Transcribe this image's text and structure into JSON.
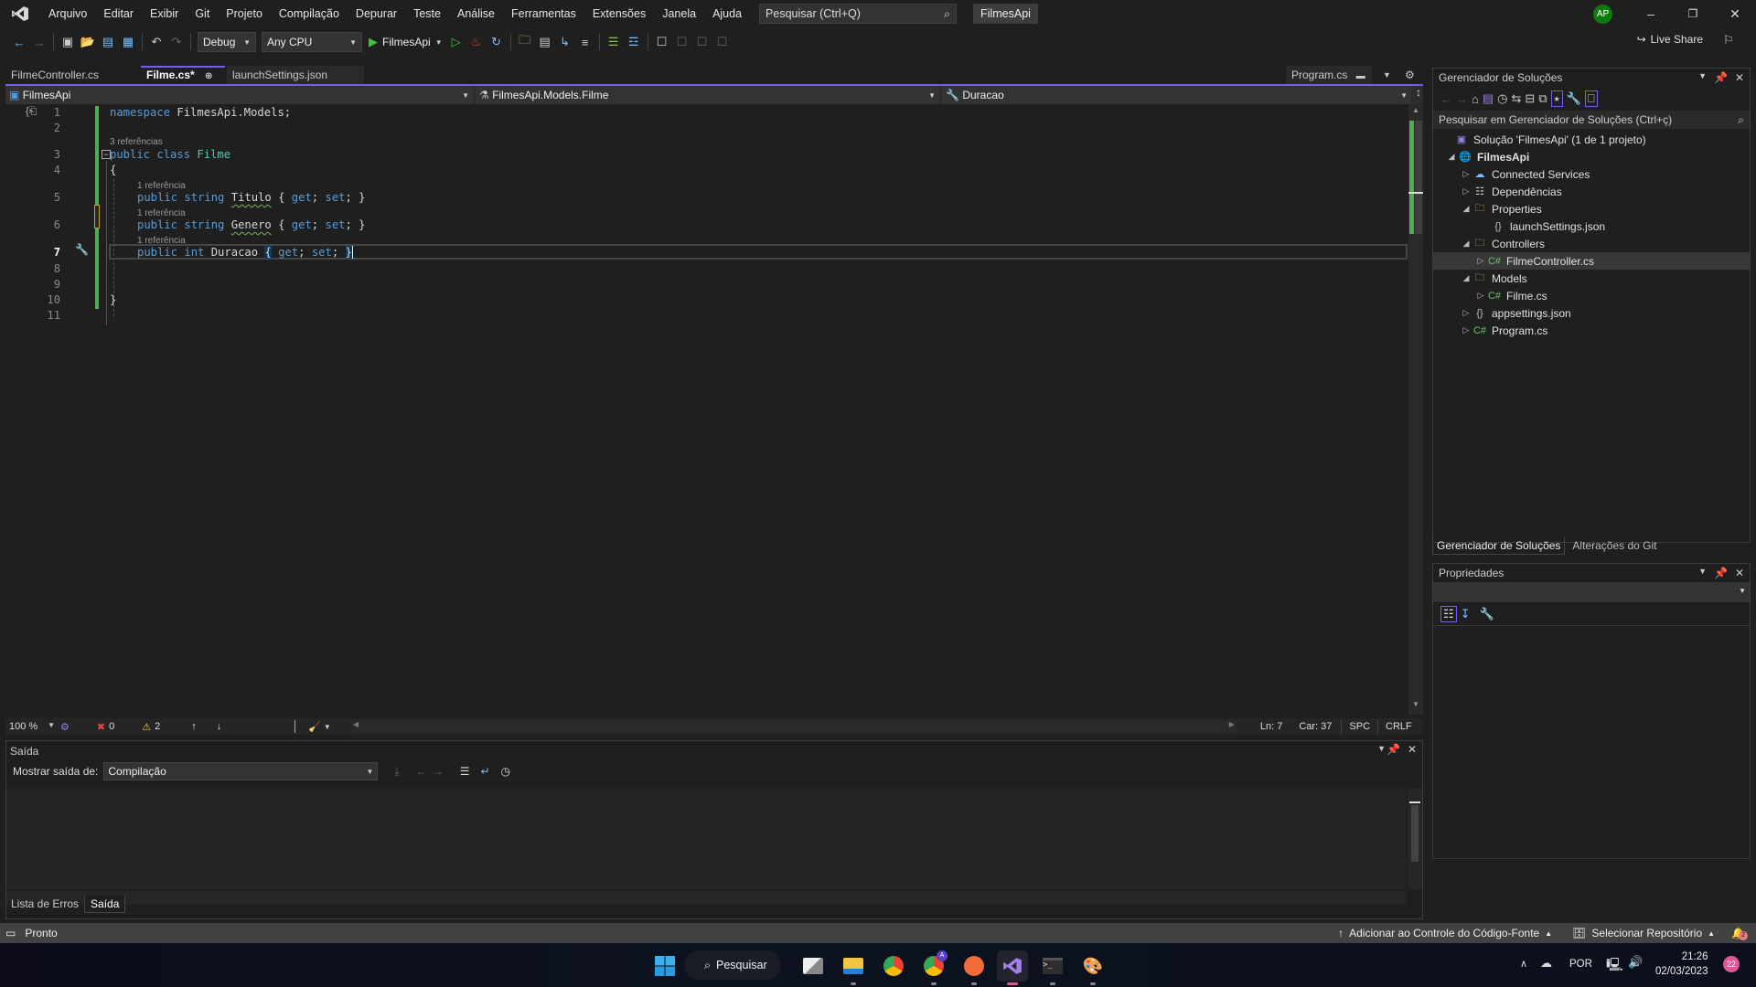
{
  "titlebar": {
    "menu": [
      "Arquivo",
      "Editar",
      "Exibir",
      "Git",
      "Projeto",
      "Compilação",
      "Depurar",
      "Teste",
      "Análise",
      "Ferramentas",
      "Extensões",
      "Janela",
      "Ajuda"
    ],
    "search_placeholder": "Pesquisar (Ctrl+Q)",
    "solution_name": "FilmesApi",
    "avatar_initials": "AP"
  },
  "toolbar": {
    "configuration": "Debug",
    "platform": "Any CPU",
    "run_target": "FilmesApi",
    "live_share": "Live Share"
  },
  "editor": {
    "tabs": [
      {
        "label": "FilmeController.cs",
        "active": false
      },
      {
        "label": "Filme.cs*",
        "active": true
      },
      {
        "label": "launchSettings.json",
        "active": false
      }
    ],
    "pinned_tab": "Program.cs",
    "nav": {
      "project": "FilmesApi",
      "type": "FilmesApi.Models.Filme",
      "member": "Duracao"
    },
    "line_numbers": [
      "1",
      "2",
      "3",
      "4",
      "5",
      "6",
      "7",
      "8",
      "9",
      "10",
      "11"
    ],
    "codelens": {
      "class_refs": "3 referências",
      "prop_refs": "1 referência"
    },
    "code": {
      "l1_kw": "namespace",
      "l1_rest": " FilmesApi.Models;",
      "l3_kw": "public class",
      "l3_cls": "Filme",
      "l4": "{",
      "l5_kw": "public string",
      "l5_name": "Titulo",
      "l5_acc1": "get",
      "l5_acc2": "set",
      "l6_kw": "public string",
      "l6_name": "Genero",
      "l6_acc1": "get",
      "l6_acc2": "set",
      "l7_kw": "public int",
      "l7_name": "Duracao",
      "l7_acc1": "get",
      "l7_acc2": "set",
      "l10": "}"
    },
    "status": {
      "zoom": "100 %",
      "errors": "0",
      "warnings": "2",
      "line": "Ln: 7",
      "col": "Car: 37",
      "indent": "SPC",
      "eol": "CRLF"
    }
  },
  "output": {
    "title": "Saída",
    "show_from_label": "Mostrar saída de:",
    "show_from_value": "Compilação",
    "bottom_tabs": [
      {
        "label": "Lista de Erros",
        "active": false
      },
      {
        "label": "Saída",
        "active": true
      }
    ]
  },
  "solution_explorer": {
    "title": "Gerenciador de Soluções",
    "search_placeholder": "Pesquisar em Gerenciador de Soluções (Ctrl+ç)",
    "tree": [
      {
        "label": "Solução 'FilmesApi' (1 de 1 projeto)",
        "icon": "solution-icon",
        "twisty": ""
      },
      {
        "label": "FilmesApi",
        "icon": "web-project-icon",
        "twisty": "expanded"
      },
      {
        "label": "Connected Services",
        "icon": "connected-services-icon",
        "twisty": "collapsed"
      },
      {
        "label": "Dependências",
        "icon": "dependencies-icon",
        "twisty": "collapsed"
      },
      {
        "label": "Properties",
        "icon": "properties-folder-icon",
        "twisty": "expanded"
      },
      {
        "label": "launchSettings.json",
        "icon": "json-file-icon",
        "twisty": ""
      },
      {
        "label": "Controllers",
        "icon": "folder-icon",
        "twisty": "expanded"
      },
      {
        "label": "FilmeController.cs",
        "icon": "csharp-file-icon",
        "twisty": "collapsed",
        "selected": true
      },
      {
        "label": "Models",
        "icon": "folder-icon",
        "twisty": "expanded"
      },
      {
        "label": "Filme.cs",
        "icon": "csharp-file-icon",
        "twisty": "collapsed"
      },
      {
        "label": "appsettings.json",
        "icon": "json-file-icon",
        "twisty": "collapsed"
      },
      {
        "label": "Program.cs",
        "icon": "csharp-file-icon",
        "twisty": "collapsed"
      }
    ],
    "tabs": [
      "Gerenciador de Soluções",
      "Alterações do Git"
    ]
  },
  "properties": {
    "title": "Propriedades"
  },
  "statusbar": {
    "ready": "Pronto",
    "source_control": "Adicionar ao Controle do Código-Fonte",
    "repository": "Selecionar Repositório",
    "notifications": "2"
  },
  "taskbar": {
    "search_label": "Pesquisar",
    "language": "POR",
    "time": "21:26",
    "date": "02/03/2023",
    "notification_count": "22"
  }
}
